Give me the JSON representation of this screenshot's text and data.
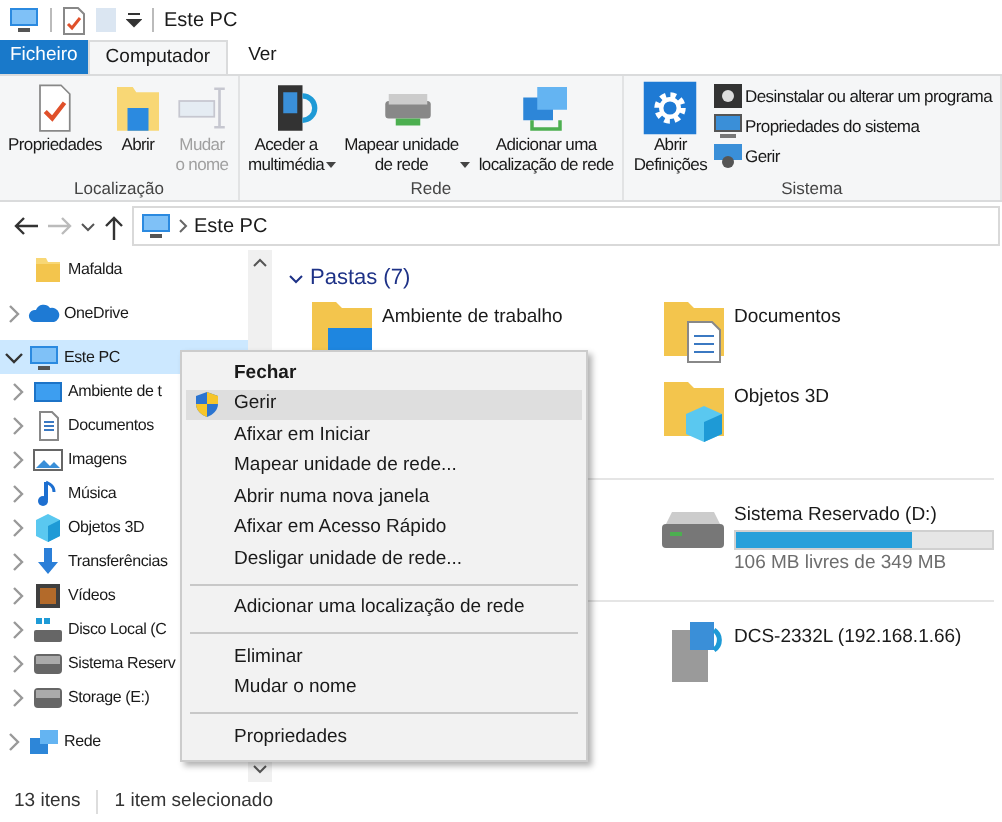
{
  "title_bar": {
    "title": "Este PC"
  },
  "ribbon_tabs": [
    {
      "label": "Ficheiro",
      "kind": "file",
      "selected": false
    },
    {
      "label": "Computador",
      "kind": "tab",
      "selected": true
    },
    {
      "label": "Ver",
      "kind": "tab",
      "selected": false
    }
  ],
  "ribbon_groups": [
    {
      "label": "Localização",
      "buttons": [
        {
          "label": "Propriedades",
          "kind": "properties",
          "disabled": false,
          "dropdown": false
        },
        {
          "label": "Abrir",
          "kind": "open",
          "disabled": false,
          "dropdown": false
        },
        {
          "label": "Mudar\no nome",
          "kind": "rename",
          "disabled": true,
          "dropdown": false
        }
      ]
    },
    {
      "label": "Rede",
      "buttons": [
        {
          "label": "Aceder a\nmultimédia",
          "kind": "media",
          "disabled": false,
          "dropdown": true
        },
        {
          "label": "Mapear unidade\nde rede",
          "kind": "map-drive",
          "disabled": false,
          "dropdown": true
        },
        {
          "label": "Adicionar uma\nlocalização de rede",
          "kind": "network-location",
          "disabled": false,
          "dropdown": false
        }
      ]
    },
    {
      "label": "Sistema",
      "buttons": [
        {
          "label": "Abrir\nDefinições",
          "kind": "settings",
          "disabled": false,
          "dropdown": false
        }
      ],
      "small_buttons": [
        {
          "label": "Desinstalar ou alterar um programa",
          "kind": "uninstall"
        },
        {
          "label": "Propriedades do sistema",
          "kind": "system"
        },
        {
          "label": "Gerir",
          "kind": "manage"
        }
      ]
    }
  ],
  "address_bar": {
    "path": "Este PC"
  },
  "navigation_tree": [
    {
      "children": [
        {
          "label": "Mafalda",
          "kind": "folder",
          "selected": false
        }
      ]
    },
    {
      "label": "OneDrive",
      "kind": "cloud",
      "selected": false,
      "expanded": false
    },
    {
      "label": "Este PC",
      "kind": "computer",
      "selected": true,
      "expanded": true,
      "children": [
        {
          "label": "Ambiente de t",
          "kind": "desktop",
          "selected": false,
          "expanded": false
        },
        {
          "label": "Documentos",
          "kind": "documents",
          "selected": false,
          "expanded": false
        },
        {
          "label": "Imagens",
          "kind": "pictures",
          "selected": false,
          "expanded": false
        },
        {
          "label": "Música",
          "kind": "music",
          "selected": false,
          "expanded": false
        },
        {
          "label": "Objetos 3D",
          "kind": "objects3d",
          "selected": false,
          "expanded": false
        },
        {
          "label": "Transferências",
          "kind": "downloads",
          "selected": false,
          "expanded": false
        },
        {
          "label": "Vídeos",
          "kind": "videos",
          "selected": false,
          "expanded": false
        },
        {
          "label": "Disco Local (C",
          "kind": "system-drive",
          "selected": false,
          "expanded": false
        },
        {
          "label": "Sistema Reserv",
          "kind": "drive",
          "selected": false,
          "expanded": false
        },
        {
          "label": "Storage (E:)",
          "kind": "drive",
          "selected": false,
          "expanded": false
        }
      ]
    },
    {
      "label": "Rede",
      "kind": "network",
      "selected": false,
      "expanded": false
    }
  ],
  "content": {
    "groups": [
      {
        "title": "Pastas (7)",
        "expanded": true,
        "columns": [
          [
            {
              "label": "Ambiente de trabalho",
              "kind": "desktop"
            }
          ],
          [
            {
              "label": "Documentos",
              "kind": "documents"
            },
            {
              "label": "Objetos 3D",
              "kind": "objects3d"
            }
          ]
        ]
      },
      {
        "items": [
          {
            "label": "Sistema Reservado (D:)",
            "kind": "drive",
            "level": 0.69,
            "detail": "106 MB livres de 349 MB"
          }
        ]
      },
      {
        "items": [
          {
            "label": "DCS-2332L (192.168.1.66)",
            "kind": "media-device"
          }
        ]
      }
    ]
  },
  "context_menu": {
    "items": [
      {
        "kind": "item",
        "label": "Fechar",
        "default": true,
        "selected": false
      },
      {
        "kind": "shield-item",
        "label": "Gerir",
        "default": false,
        "selected": true
      },
      {
        "kind": "item",
        "label": "Afixar em Iniciar",
        "default": false,
        "selected": false
      },
      {
        "kind": "item",
        "label": "Mapear unidade de rede...",
        "default": false,
        "selected": false
      },
      {
        "kind": "item",
        "label": "Abrir numa nova janela",
        "default": false,
        "selected": false
      },
      {
        "kind": "item",
        "label": "Afixar em Acesso Rápido",
        "default": false,
        "selected": false
      },
      {
        "kind": "item",
        "label": "Desligar unidade de rede...",
        "default": false,
        "selected": false
      },
      {
        "kind": "separator"
      },
      {
        "kind": "item",
        "label": "Adicionar uma localização de rede",
        "default": false,
        "selected": false
      },
      {
        "kind": "separator"
      },
      {
        "kind": "item",
        "label": "Eliminar",
        "default": false,
        "selected": false
      },
      {
        "kind": "item",
        "label": "Mudar o nome",
        "default": false,
        "selected": false
      },
      {
        "kind": "separator"
      },
      {
        "kind": "item",
        "label": "Propriedades",
        "default": false,
        "selected": false
      }
    ]
  },
  "status_bar": {
    "item_count": "13 itens",
    "selection": "1 item selecionado"
  }
}
